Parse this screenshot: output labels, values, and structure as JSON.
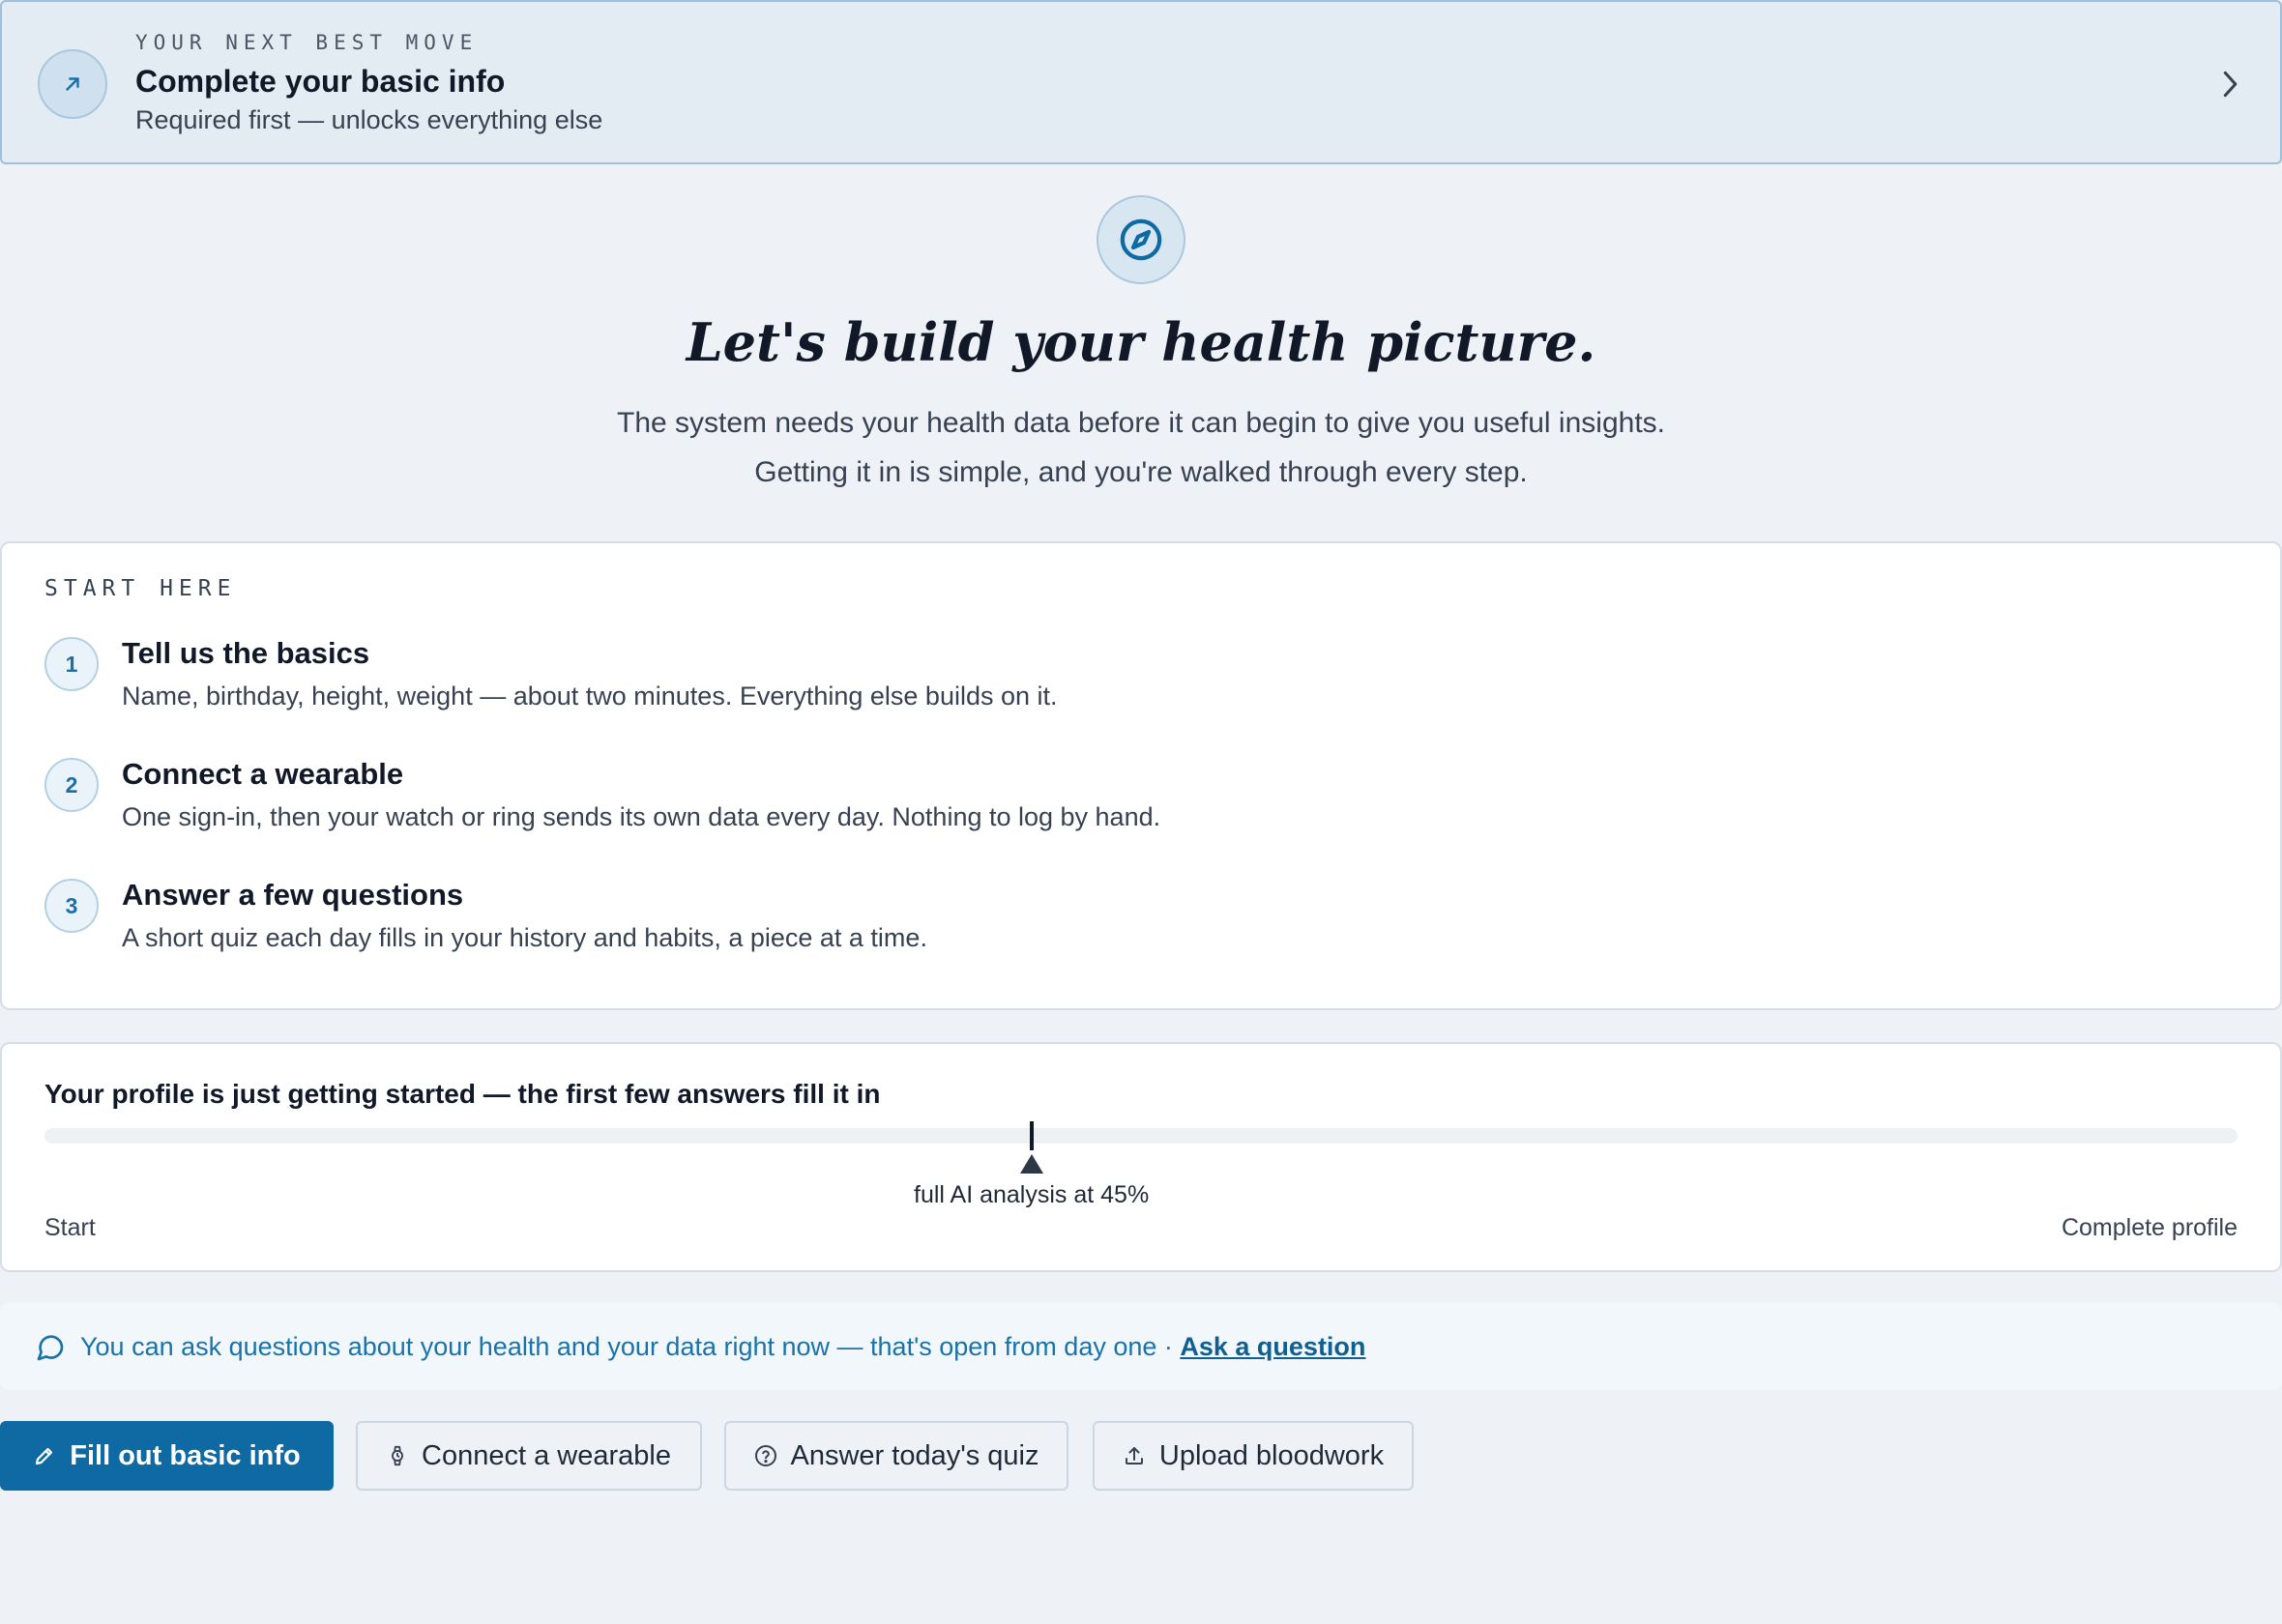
{
  "banner": {
    "eyebrow": "YOUR NEXT BEST MOVE",
    "title": "Complete your basic info",
    "subtitle": "Required first — unlocks everything else",
    "icon": "arrow-up-right-icon",
    "chevron": "chevron-right-icon"
  },
  "hero": {
    "icon": "compass-icon",
    "title": "Let's build your health picture.",
    "body": "The system needs your health data before it can begin to give you useful insights. Getting it in is simple, and you're walked through every step."
  },
  "steps": {
    "eyebrow": "START HERE",
    "items": [
      {
        "number": "1",
        "title": "Tell us the basics",
        "description": "Name, birthday, height, weight — about two minutes. Everything else builds on it."
      },
      {
        "number": "2",
        "title": "Connect a wearable",
        "description": "One sign-in, then your watch or ring sends its own data every day. Nothing to log by hand."
      },
      {
        "number": "3",
        "title": "Answer a few questions",
        "description": "A short quiz each day fills in your history and habits, a piece at a time."
      }
    ]
  },
  "progress": {
    "title": "Your profile is just getting started — the first few answers fill it in",
    "value_percent": 0,
    "marker_percent": 45,
    "marker_label": "full AI analysis at 45%",
    "start_label": "Start",
    "end_label": "Complete profile"
  },
  "ask": {
    "icon": "chat-bubble-icon",
    "text": "You can ask questions about your health and your data right now — that's open from day one · ",
    "link": "Ask a question"
  },
  "actions": [
    {
      "label": "Fill out basic info",
      "icon": "pencil-icon",
      "primary": true
    },
    {
      "label": "Connect a wearable",
      "icon": "watch-icon",
      "primary": false
    },
    {
      "label": "Answer today's quiz",
      "icon": "question-circle-icon",
      "primary": false
    },
    {
      "label": "Upload bloodwork",
      "icon": "upload-icon",
      "primary": false
    }
  ],
  "colors": {
    "accent": "#0f6aa3",
    "link": "#1a73a8",
    "background": "#eef2f6",
    "banner_bg": "#e3ebf3"
  }
}
